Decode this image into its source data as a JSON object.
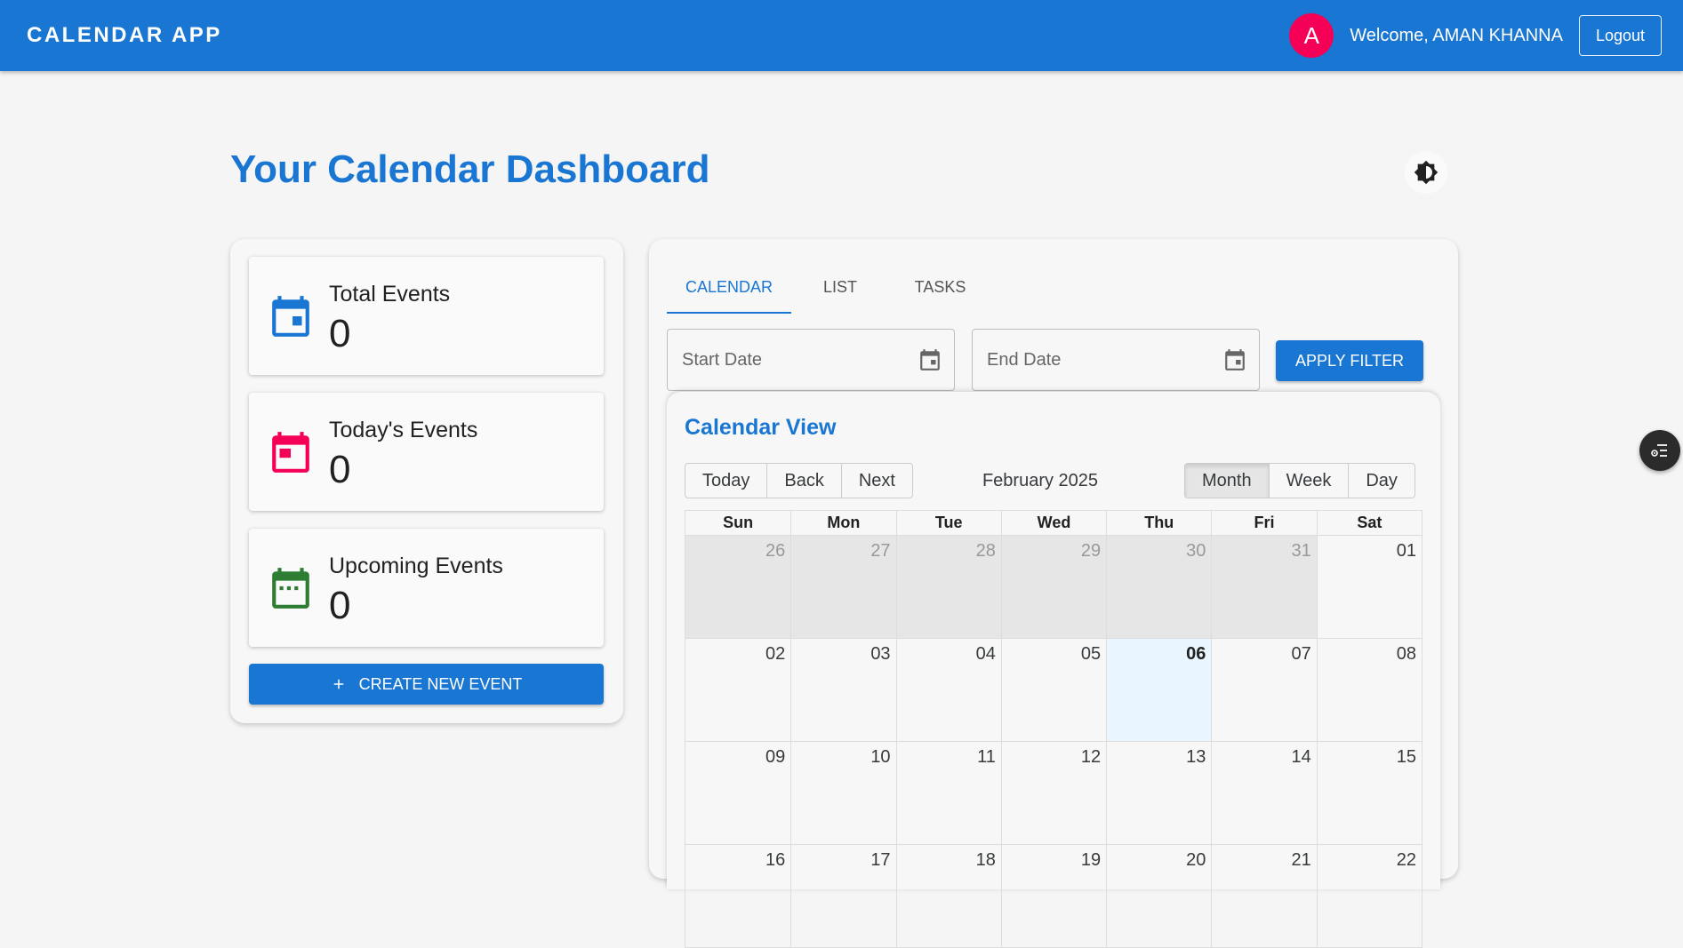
{
  "appbar": {
    "title": "CALENDAR APP",
    "avatar_letter": "A",
    "welcome": "Welcome, AMAN KHANNA",
    "logout_label": "Logout"
  },
  "header": {
    "title": "Your Calendar Dashboard",
    "theme_icon": "brightness-icon"
  },
  "stats": [
    {
      "label": "Total Events",
      "value": "0",
      "icon": "calendar-today-icon",
      "color": "#1976d2"
    },
    {
      "label": "Today's Events",
      "value": "0",
      "icon": "calendar-event-icon",
      "color": "#f50057"
    },
    {
      "label": "Upcoming Events",
      "value": "0",
      "icon": "calendar-month-icon",
      "color": "#2e7d32"
    }
  ],
  "create_button": {
    "label": "CREATE NEW EVENT",
    "icon": "plus-icon"
  },
  "tabs": [
    {
      "label": "CALENDAR",
      "active": true
    },
    {
      "label": "LIST",
      "active": false
    },
    {
      "label": "TASKS",
      "active": false
    }
  ],
  "filter": {
    "start_placeholder": "Start Date",
    "end_placeholder": "End Date",
    "apply_label": "APPLY FILTER"
  },
  "calendar": {
    "title": "Calendar View",
    "nav": {
      "today": "Today",
      "back": "Back",
      "next": "Next"
    },
    "label": "February 2025",
    "views": {
      "month": "Month",
      "week": "Week",
      "day": "Day"
    },
    "active_view": "month",
    "weekdays": [
      "Sun",
      "Mon",
      "Tue",
      "Wed",
      "Thu",
      "Fri",
      "Sat"
    ],
    "weeks": [
      [
        "26",
        "27",
        "28",
        "29",
        "30",
        "31",
        "01"
      ],
      [
        "02",
        "03",
        "04",
        "05",
        "06",
        "07",
        "08"
      ],
      [
        "09",
        "10",
        "11",
        "12",
        "13",
        "14",
        "15"
      ],
      [
        "16",
        "17",
        "18",
        "19",
        "20",
        "21",
        "22"
      ]
    ],
    "today": "06"
  },
  "colors": {
    "primary": "#1976d2",
    "accent": "#f50057",
    "success": "#2e7d32"
  }
}
